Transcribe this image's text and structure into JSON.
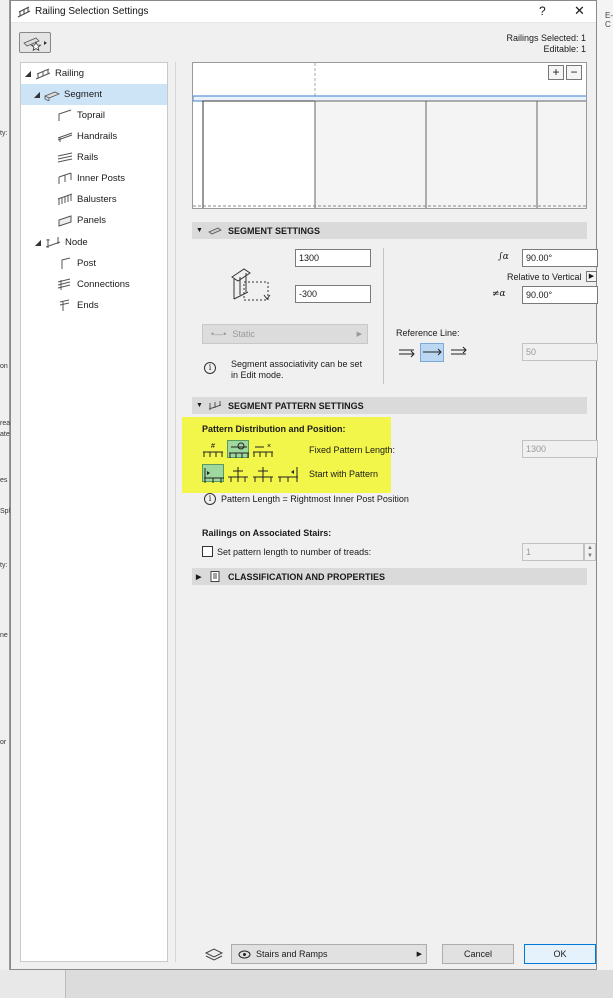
{
  "dialog": {
    "title": "Railing Selection Settings",
    "help": "?",
    "close": "✕",
    "railings_selected": "Railings Selected: 1",
    "editable": "Editable: 1"
  },
  "tree": {
    "items": [
      {
        "label": "Railing",
        "twisty": "◢",
        "level": 0
      },
      {
        "label": "Segment",
        "twisty": "◢",
        "level": 1,
        "selected": true
      },
      {
        "label": "Toprail",
        "level": 2
      },
      {
        "label": "Handrails",
        "level": 2
      },
      {
        "label": "Rails",
        "level": 2
      },
      {
        "label": "Inner Posts",
        "level": 2
      },
      {
        "label": "Balusters",
        "level": 2
      },
      {
        "label": "Panels",
        "level": 2
      },
      {
        "label": "Node",
        "twisty": "◢",
        "level": 1
      },
      {
        "label": "Post",
        "level": 2
      },
      {
        "label": "Connections",
        "level": 2
      },
      {
        "label": "Ends",
        "level": 2
      }
    ]
  },
  "preview": {
    "zoom_in": "+",
    "zoom_out": "−"
  },
  "segment_settings": {
    "header": "SEGMENT SETTINGS",
    "height_value": "1300",
    "offset_value": "-300",
    "angle_top_value": "90.00°",
    "relative_to_vertical": "Relative to Vertical",
    "angle_bottom_value": "90.00°",
    "static_label": "Static",
    "assoc_note_line1": "Segment associativity can be set",
    "assoc_note_line2": "in Edit mode.",
    "reference_line_label": "Reference Line:",
    "reference_offset_value": "50"
  },
  "pattern_settings": {
    "header": "SEGMENT PATTERN SETTINGS",
    "distribution_label": "Pattern Distribution and Position:",
    "fixed_pattern_length": "Fixed Pattern Length:",
    "fixed_pattern_value": "1300",
    "start_with_pattern": "Start with Pattern",
    "pattern_length_note": "Pattern Length = Rightmost Inner Post Position",
    "stairs_label": "Railings on Associated Stairs:",
    "treads_checkbox_label": "Set pattern length to number of treads:",
    "treads_value": "1"
  },
  "classification": {
    "header": "CLASSIFICATION AND PROPERTIES"
  },
  "footer": {
    "layer_value": "Stairs and Ramps",
    "cancel": "Cancel",
    "ok": "OK"
  },
  "colors": {
    "highlight": "#f2f54a",
    "selected_tree": "#cde4f7",
    "ok_border": "#0078d7"
  }
}
